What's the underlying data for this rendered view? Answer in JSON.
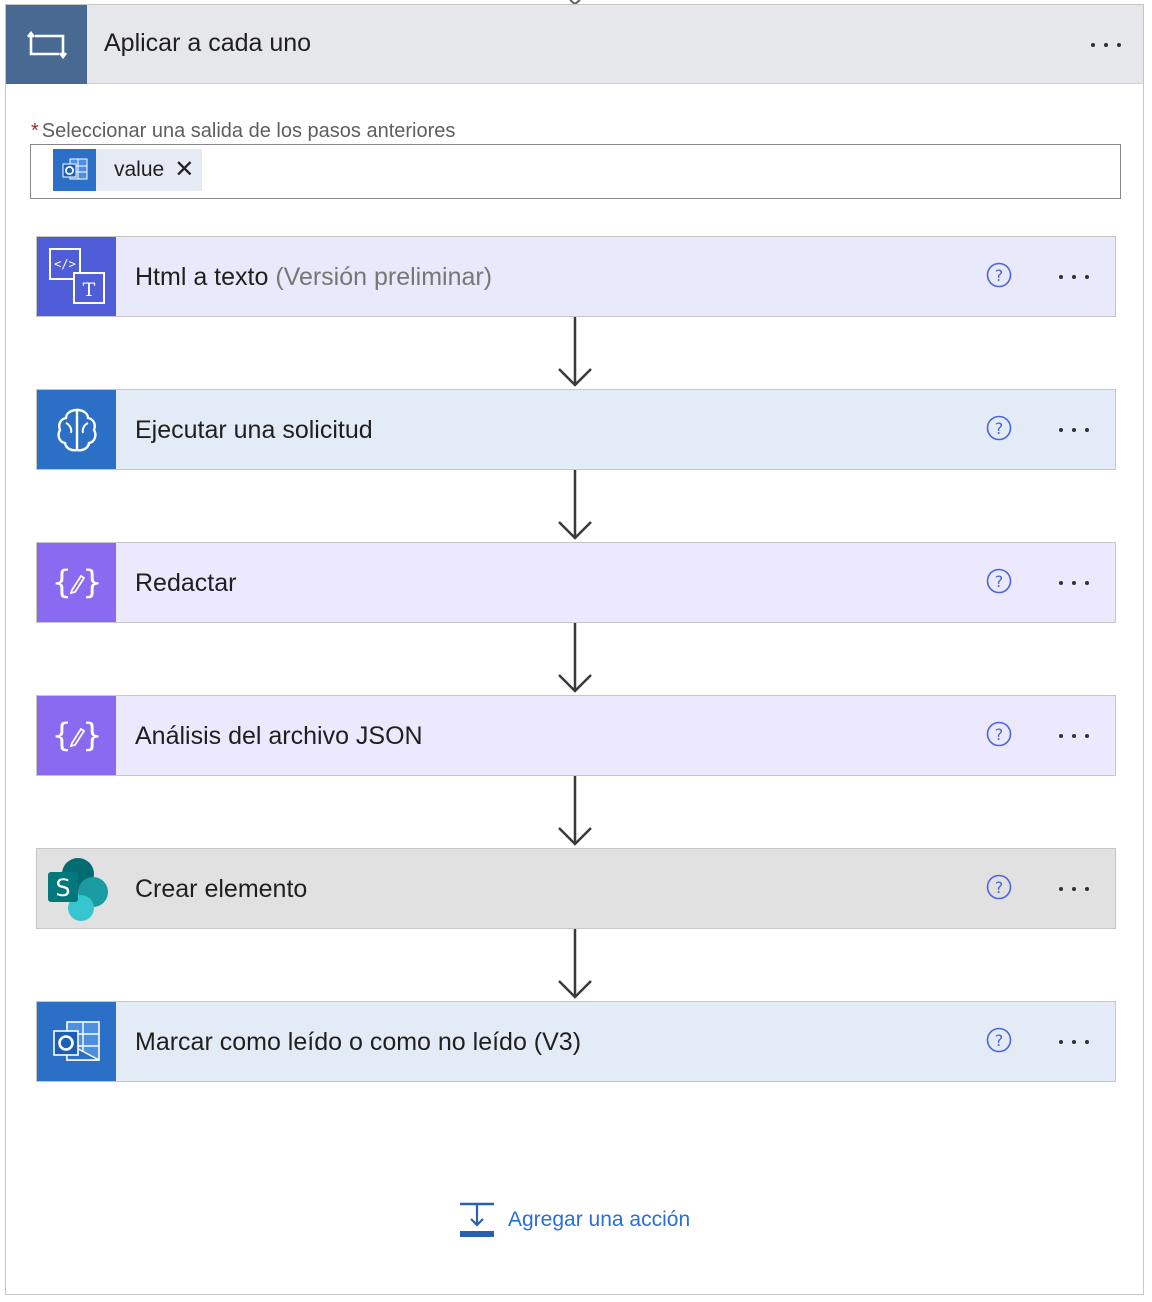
{
  "scope": {
    "title": "Aplicar a cada uno",
    "field_label": "Seleccionar una salida de los pasos anteriores",
    "required_mark": "*",
    "token": {
      "label": "value",
      "icon": "outlook-icon"
    }
  },
  "actions": [
    {
      "title": "Html a texto",
      "subtitle": "(Versión preliminar)",
      "icon": "html-to-text-icon",
      "icon_bg": "#4f5ed8",
      "card_bg": "#e8e9fa"
    },
    {
      "title": "Ejecutar una solicitud",
      "icon": "brain-icon",
      "icon_bg": "#2c6fc7",
      "card_bg": "#e3ebf7"
    },
    {
      "title": "Redactar",
      "icon": "compose-icon",
      "icon_bg": "#8a6af0",
      "card_bg": "#ece8fd"
    },
    {
      "title": "Análisis del archivo JSON",
      "icon": "compose-icon",
      "icon_bg": "#8a6af0",
      "card_bg": "#ece8fd"
    },
    {
      "title": "Crear elemento",
      "icon": "sharepoint-icon",
      "icon_bg": "#e1e1e1",
      "card_bg": "#e1e1e1"
    },
    {
      "title": "Marcar como leído o como no leído (V3)",
      "icon": "outlook-icon",
      "icon_bg": "#2c6fc7",
      "card_bg": "#e3ebf7"
    }
  ],
  "add_action": {
    "label": "Agregar una acción",
    "icon": "add-action-icon"
  },
  "colors": {
    "scope_header_bg": "#e6e7ea",
    "scope_icon_bg": "#486991",
    "link": "#2b6ed6",
    "help": "#4a65e0"
  }
}
